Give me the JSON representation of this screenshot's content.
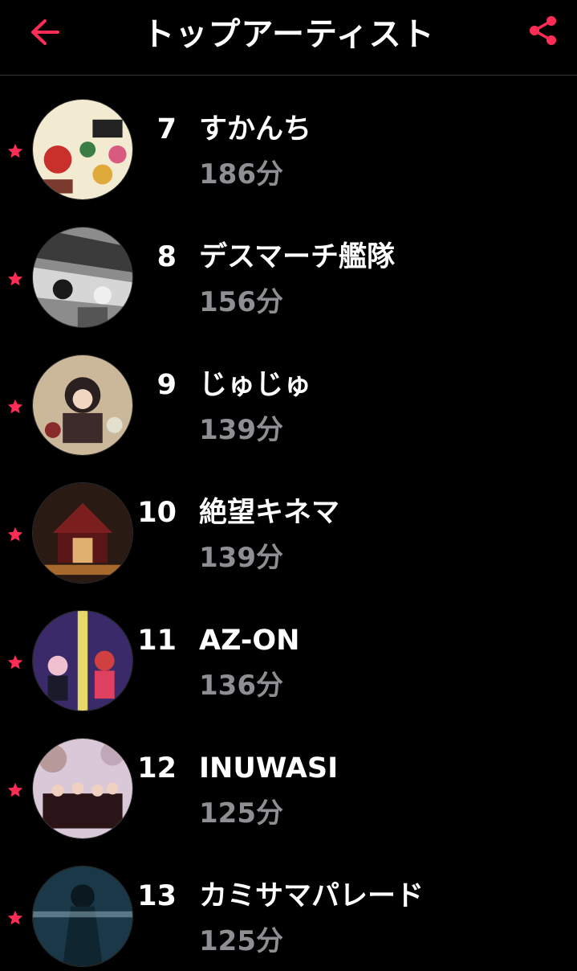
{
  "header": {
    "title": "トップアーティスト",
    "back_icon": "back-arrow-icon",
    "share_icon": "share-icon",
    "accent_color": "#ff2d55"
  },
  "artists": [
    {
      "rank": "7",
      "name": "すかんち",
      "minutes": "186分",
      "artwork_icon": "artist-artwork"
    },
    {
      "rank": "8",
      "name": "デスマーチ艦隊",
      "minutes": "156分",
      "artwork_icon": "artist-artwork"
    },
    {
      "rank": "9",
      "name": "じゅじゅ",
      "minutes": "139分",
      "artwork_icon": "artist-artwork"
    },
    {
      "rank": "10",
      "name": "絶望キネマ",
      "minutes": "139分",
      "artwork_icon": "artist-artwork"
    },
    {
      "rank": "11",
      "name": "AZ-ON",
      "minutes": "136分",
      "artwork_icon": "artist-artwork"
    },
    {
      "rank": "12",
      "name": "INUWASI",
      "minutes": "125分",
      "artwork_icon": "artist-artwork"
    },
    {
      "rank": "13",
      "name": "カミサマパレード",
      "minutes": "125分",
      "artwork_icon": "artist-artwork"
    }
  ],
  "favorite_icon": "star-icon"
}
